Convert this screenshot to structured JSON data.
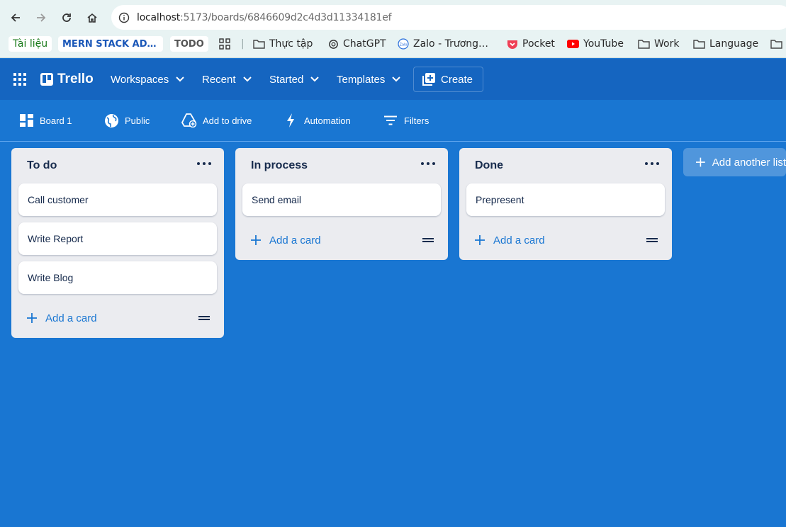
{
  "browser": {
    "url_host": "localhost",
    "url_path": ":5173/boards/6846609d2c4d3d11334181ef",
    "bookmarks": [
      {
        "label": "Tài liệu",
        "icon": "green-chip"
      },
      {
        "label": "MERN STACK AD…",
        "icon": "blue-chip"
      },
      {
        "label": "TODO",
        "icon": "gray-chip"
      },
      {
        "label": "",
        "icon": "apps-grid-icon"
      },
      {
        "label": "Thực tập",
        "icon": "folder-icon"
      },
      {
        "label": "ChatGPT",
        "icon": "chatgpt-icon"
      },
      {
        "label": "Zalo - Trương…",
        "icon": "zalo-icon"
      },
      {
        "label": "Pocket",
        "icon": "pocket-icon"
      },
      {
        "label": "YouTube",
        "icon": "youtube-icon"
      },
      {
        "label": "Work",
        "icon": "folder-icon"
      },
      {
        "label": "Language",
        "icon": "folder-icon"
      }
    ]
  },
  "header": {
    "logo": "Trello",
    "nav": [
      "Workspaces",
      "Recent",
      "Started",
      "Templates"
    ],
    "create_label": "Create"
  },
  "board_bar": {
    "items": [
      "Board 1",
      "Public",
      "Add to drive",
      "Automation",
      "Filters"
    ]
  },
  "columns": [
    {
      "title": "To do",
      "cards": [
        "Call customer",
        "Write Report",
        "Write Blog"
      ],
      "add_label": "Add a card"
    },
    {
      "title": "In process",
      "cards": [
        "Send email"
      ],
      "add_label": "Add a card"
    },
    {
      "title": "Done",
      "cards": [
        "Prepresent"
      ],
      "add_label": "Add a card"
    }
  ],
  "add_list_label": "Add another list",
  "colors": {
    "header_bg": "#1565c0",
    "board_bg": "#1976d2",
    "column_bg": "#ebecf0",
    "accent_text": "#1976d2"
  }
}
